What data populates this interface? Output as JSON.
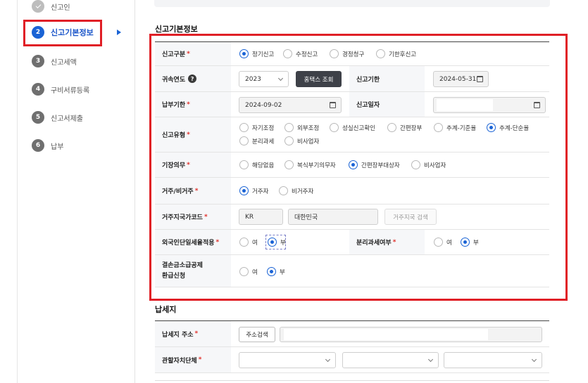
{
  "sidebar": {
    "steps": [
      {
        "num": "",
        "label": "신고인"
      },
      {
        "num": "2",
        "label": "신고기본정보"
      },
      {
        "num": "3",
        "label": "신고세액"
      },
      {
        "num": "4",
        "label": "구비서류등록"
      },
      {
        "num": "5",
        "label": "신고서제출"
      },
      {
        "num": "6",
        "label": "납부"
      }
    ]
  },
  "section_basic": {
    "title": "신고기본정보",
    "report_type": {
      "label": "신고구분",
      "options": [
        "정기신고",
        "수정신고",
        "경정청구",
        "기한후신고"
      ],
      "selected": "정기신고"
    },
    "year": {
      "label": "귀속연도",
      "help": "?",
      "value": "2023",
      "hometax_btn": "홈택스 조회"
    },
    "deadline": {
      "label": "신고기한",
      "value": "2024-05-31"
    },
    "pay_deadline": {
      "label": "납부기한",
      "value": "2024-09-02"
    },
    "report_date": {
      "label": "신고일자",
      "value": ""
    },
    "report_kind": {
      "label": "신고유형",
      "options": [
        "자기조정",
        "외부조정",
        "성실신고확인",
        "간편장부",
        "추계-기준율",
        "추계-단순율",
        "분리과세",
        "비사업자"
      ],
      "selected": "추계-단순율"
    },
    "bookkeeping": {
      "label": "기장의무",
      "options": [
        "해당없음",
        "복식부기의무자",
        "간편장부대상자",
        "비사업자"
      ],
      "selected": "간편장부대상자"
    },
    "residency": {
      "label": "거주/비거주",
      "options": [
        "거주자",
        "비거주자"
      ],
      "selected": "거주자"
    },
    "country": {
      "label": "거주지국가코드",
      "code": "KR",
      "name": "대한민국",
      "search_btn": "거주지국 검색"
    },
    "foreign_rate": {
      "label": "외국인단일세율적용",
      "options": [
        "여",
        "부"
      ],
      "selected": "부"
    },
    "separate_tax": {
      "label": "분리과세여부",
      "options": [
        "여",
        "부"
      ],
      "selected": "부"
    },
    "loss_refund": {
      "label_line1": "결손금소급공제",
      "label_line2": "환급신청",
      "options": [
        "여",
        "부"
      ],
      "selected": "부"
    }
  },
  "section_tax_place": {
    "title": "납세지",
    "address": {
      "label": "납세지 주소",
      "search_btn": "주소검색",
      "value": ""
    },
    "local_gov": {
      "label": "관할자치단체",
      "values": [
        "",
        "",
        ""
      ]
    }
  },
  "colors": {
    "accent": "#1a63d5",
    "highlight_box": "#e01f26",
    "required": "#e0312b"
  }
}
